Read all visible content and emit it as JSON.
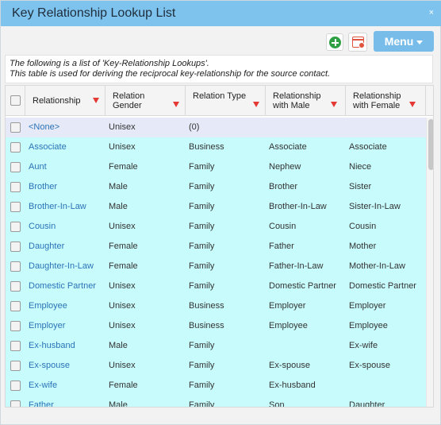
{
  "window": {
    "title": "Key Relationship Lookup List",
    "close_label": "×"
  },
  "toolbar": {
    "menu_label": "Menu"
  },
  "intro": {
    "line1": "The following is a list of 'Key-Relationship Lookups'.",
    "line2": "This table is used for deriving the reciprocal key-relationship for the source contact."
  },
  "table": {
    "columns": {
      "relationship": "Relationship",
      "gender_1": "Relation",
      "gender_2": "Gender",
      "type": "Relation Type",
      "male_1": "Relationship",
      "male_2": "with Male",
      "female_1": "Relationship",
      "female_2": "with Female"
    },
    "rows": [
      {
        "relationship": "<None>",
        "gender": "Unisex",
        "type": "(0)",
        "male": "",
        "female": ""
      },
      {
        "relationship": "Associate",
        "gender": "Unisex",
        "type": "Business",
        "male": "Associate",
        "female": "Associate"
      },
      {
        "relationship": "Aunt",
        "gender": "Female",
        "type": "Family",
        "male": "Nephew",
        "female": "Niece"
      },
      {
        "relationship": "Brother",
        "gender": "Male",
        "type": "Family",
        "male": "Brother",
        "female": "Sister"
      },
      {
        "relationship": "Brother-In-Law",
        "gender": "Male",
        "type": "Family",
        "male": "Brother-In-Law",
        "female": "Sister-In-Law"
      },
      {
        "relationship": "Cousin",
        "gender": "Unisex",
        "type": "Family",
        "male": "Cousin",
        "female": "Cousin"
      },
      {
        "relationship": "Daughter",
        "gender": "Female",
        "type": "Family",
        "male": "Father",
        "female": "Mother"
      },
      {
        "relationship": "Daughter-In-Law",
        "gender": "Female",
        "type": "Family",
        "male": "Father-In-Law",
        "female": "Mother-In-Law"
      },
      {
        "relationship": "Domestic Partner",
        "gender": "Unisex",
        "type": "Family",
        "male": "Domestic Partner",
        "female": "Domestic Partner"
      },
      {
        "relationship": "Employee",
        "gender": "Unisex",
        "type": "Business",
        "male": "Employer",
        "female": "Employer"
      },
      {
        "relationship": "Employer",
        "gender": "Unisex",
        "type": "Business",
        "male": "Employee",
        "female": "Employee"
      },
      {
        "relationship": "Ex-husband",
        "gender": "Male",
        "type": "Family",
        "male": "",
        "female": "Ex-wife"
      },
      {
        "relationship": "Ex-spouse",
        "gender": "Unisex",
        "type": "Family",
        "male": "Ex-spouse",
        "female": "Ex-spouse"
      },
      {
        "relationship": "Ex-wife",
        "gender": "Female",
        "type": "Family",
        "male": "Ex-husband",
        "female": ""
      },
      {
        "relationship": "Father",
        "gender": "Male",
        "type": "Family",
        "male": "Son",
        "female": "Daughter"
      }
    ]
  },
  "colors": {
    "titlebar": "#7ec3ee",
    "menu_button": "#78bde9",
    "row_first": "#e6e9f7",
    "row_other": "#c8fbfb",
    "link": "#2a73b8",
    "filter_icon": "#e53935"
  }
}
